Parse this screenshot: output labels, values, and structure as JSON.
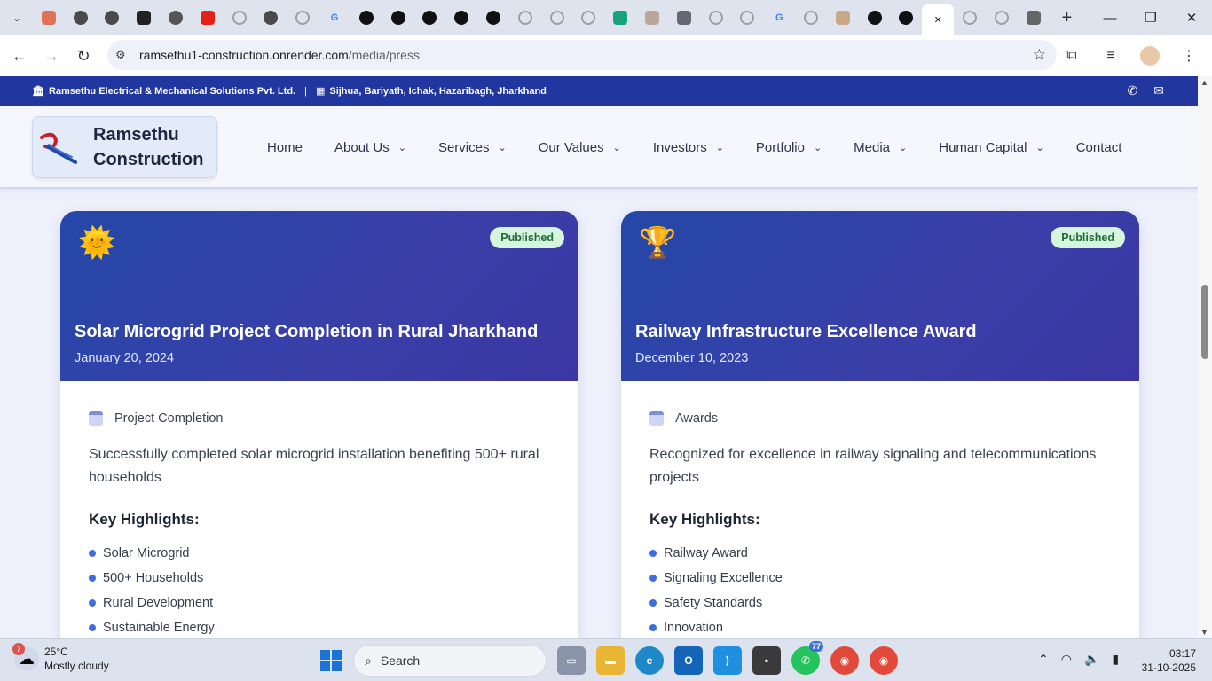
{
  "browser": {
    "tabs_count": 29,
    "active_tab_index": 28,
    "url_host": "ramsethu1-construction.onrender.com",
    "url_path": "/media/press",
    "tab_favicons": [
      "perplexity",
      "claude",
      "openai",
      "x",
      "chatgpt",
      "youtube",
      "blank",
      "openai",
      "blank",
      "google",
      "workflow",
      "workflow",
      "workflow",
      "workflow",
      "workflow",
      "blank",
      "blank",
      "blank",
      "diamond",
      "vite",
      "grid",
      "blank",
      "blank",
      "google",
      "blank",
      "avatar",
      "github",
      "github",
      "active-close",
      "blank",
      "blank",
      "chrome"
    ]
  },
  "site": {
    "company_name": "Ramsethu Electrical & Mechanical Solutions Pvt. Ltd.",
    "address": "Sijhua, Bariyath, Ichak, Hazaribagh, Jharkhand",
    "logo_line1": "Ramsethu",
    "logo_line2": "Construction",
    "nav": [
      {
        "label": "Home",
        "dropdown": false
      },
      {
        "label": "About Us",
        "dropdown": true
      },
      {
        "label": "Services",
        "dropdown": true
      },
      {
        "label": "Our Values",
        "dropdown": true
      },
      {
        "label": "Investors",
        "dropdown": true
      },
      {
        "label": "Portfolio",
        "dropdown": true
      },
      {
        "label": "Media",
        "dropdown": true
      },
      {
        "label": "Human Capital",
        "dropdown": true
      },
      {
        "label": "Contact",
        "dropdown": false
      }
    ]
  },
  "cards": [
    {
      "emoji": "🌞",
      "status": "Published",
      "title": "Solar Microgrid Project Completion in Rural Jharkhand",
      "date": "January 20, 2024",
      "category": "Project Completion",
      "description": "Successfully completed solar microgrid installation benefiting 500+ rural households",
      "highlights_label": "Key Highlights:",
      "highlights": [
        "Solar Microgrid",
        "500+ Households",
        "Rural Development",
        "Sustainable Energy"
      ]
    },
    {
      "emoji": "🏆",
      "status": "Published",
      "title": "Railway Infrastructure Excellence Award",
      "date": "December 10, 2023",
      "category": "Awards",
      "description": "Recognized for excellence in railway signaling and telecommunications projects",
      "highlights_label": "Key Highlights:",
      "highlights": [
        "Railway Award",
        "Signaling Excellence",
        "Safety Standards",
        "Innovation"
      ]
    }
  ],
  "taskbar": {
    "weather_temp": "25°C",
    "weather_desc": "Mostly cloudy",
    "weather_badge": "7",
    "search_label": "Search",
    "whatsapp_badge": "77",
    "time": "03:17",
    "date": "31-10-2025"
  },
  "colors": {
    "brand_dark": "#21369e",
    "card_gradient_start": "#2447a8",
    "card_gradient_end": "#3b36a3",
    "badge_bg": "#d6f5df",
    "bullet": "#3b6fe0"
  }
}
